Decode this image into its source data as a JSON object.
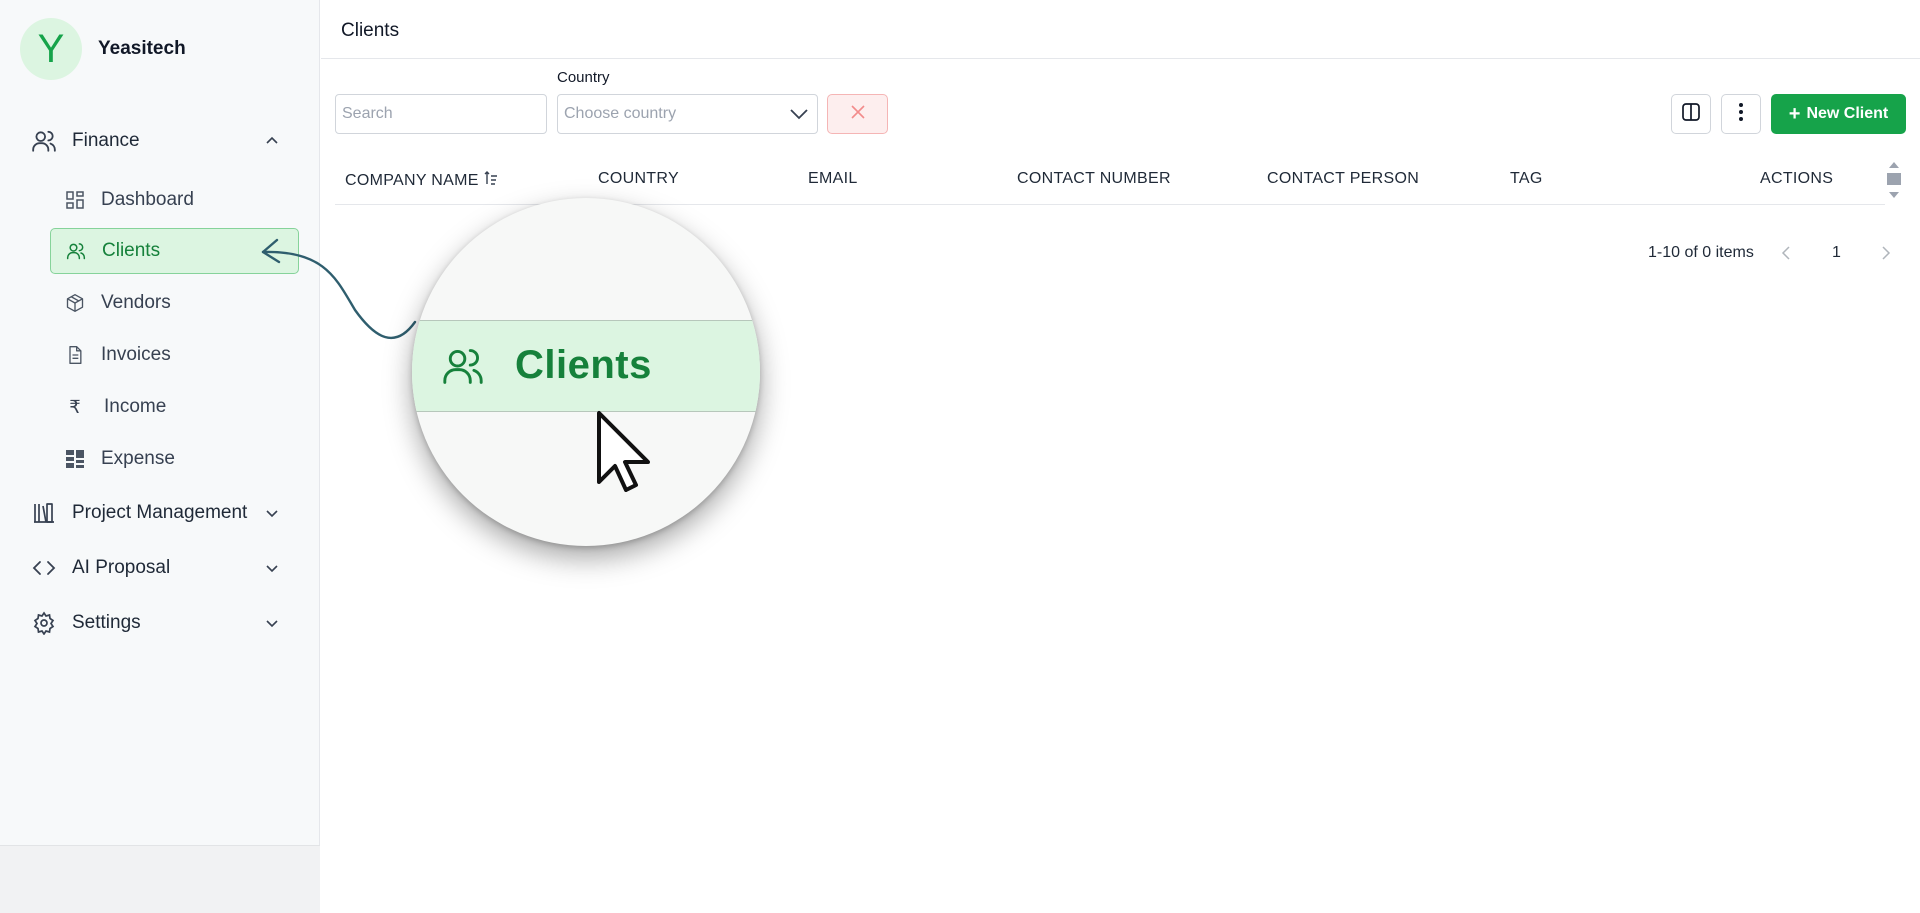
{
  "brand": {
    "initial": "Y",
    "name": "Yeasitech"
  },
  "sidebar": {
    "finance": {
      "label": "Finance"
    },
    "items": [
      {
        "label": "Dashboard",
        "icon": "dashboard-icon"
      },
      {
        "label": "Clients",
        "icon": "users-icon",
        "active": true
      },
      {
        "label": "Vendors",
        "icon": "box-icon"
      },
      {
        "label": "Invoices",
        "icon": "file-icon"
      },
      {
        "label": "Income",
        "icon": "rupee-icon"
      },
      {
        "label": "Expense",
        "icon": "expense-icon"
      }
    ],
    "groups": [
      {
        "label": "Project Management",
        "icon": "library-icon"
      },
      {
        "label": "AI Proposal",
        "icon": "code-icon"
      },
      {
        "label": "Settings",
        "icon": "gear-icon"
      }
    ]
  },
  "header": {
    "title": "Clients"
  },
  "filters": {
    "search_placeholder": "Search",
    "country_label": "Country",
    "country_placeholder": "Choose country"
  },
  "toolbar": {
    "new_client_label": "New Client"
  },
  "table": {
    "columns": [
      "COMPANY NAME",
      "COUNTRY",
      "EMAIL",
      "CONTACT NUMBER",
      "CONTACT PERSON",
      "TAG",
      "ACTIONS"
    ],
    "sort_icon": "sort-ascending-icon"
  },
  "pagination": {
    "summary": "1-10 of 0 items",
    "current_page": "1"
  },
  "magnifier": {
    "label": "Clients"
  },
  "colors": {
    "accent": "#16a34a",
    "active_bg": "#dcf5e1",
    "active_text": "#16813b",
    "danger": "#ef4444"
  }
}
